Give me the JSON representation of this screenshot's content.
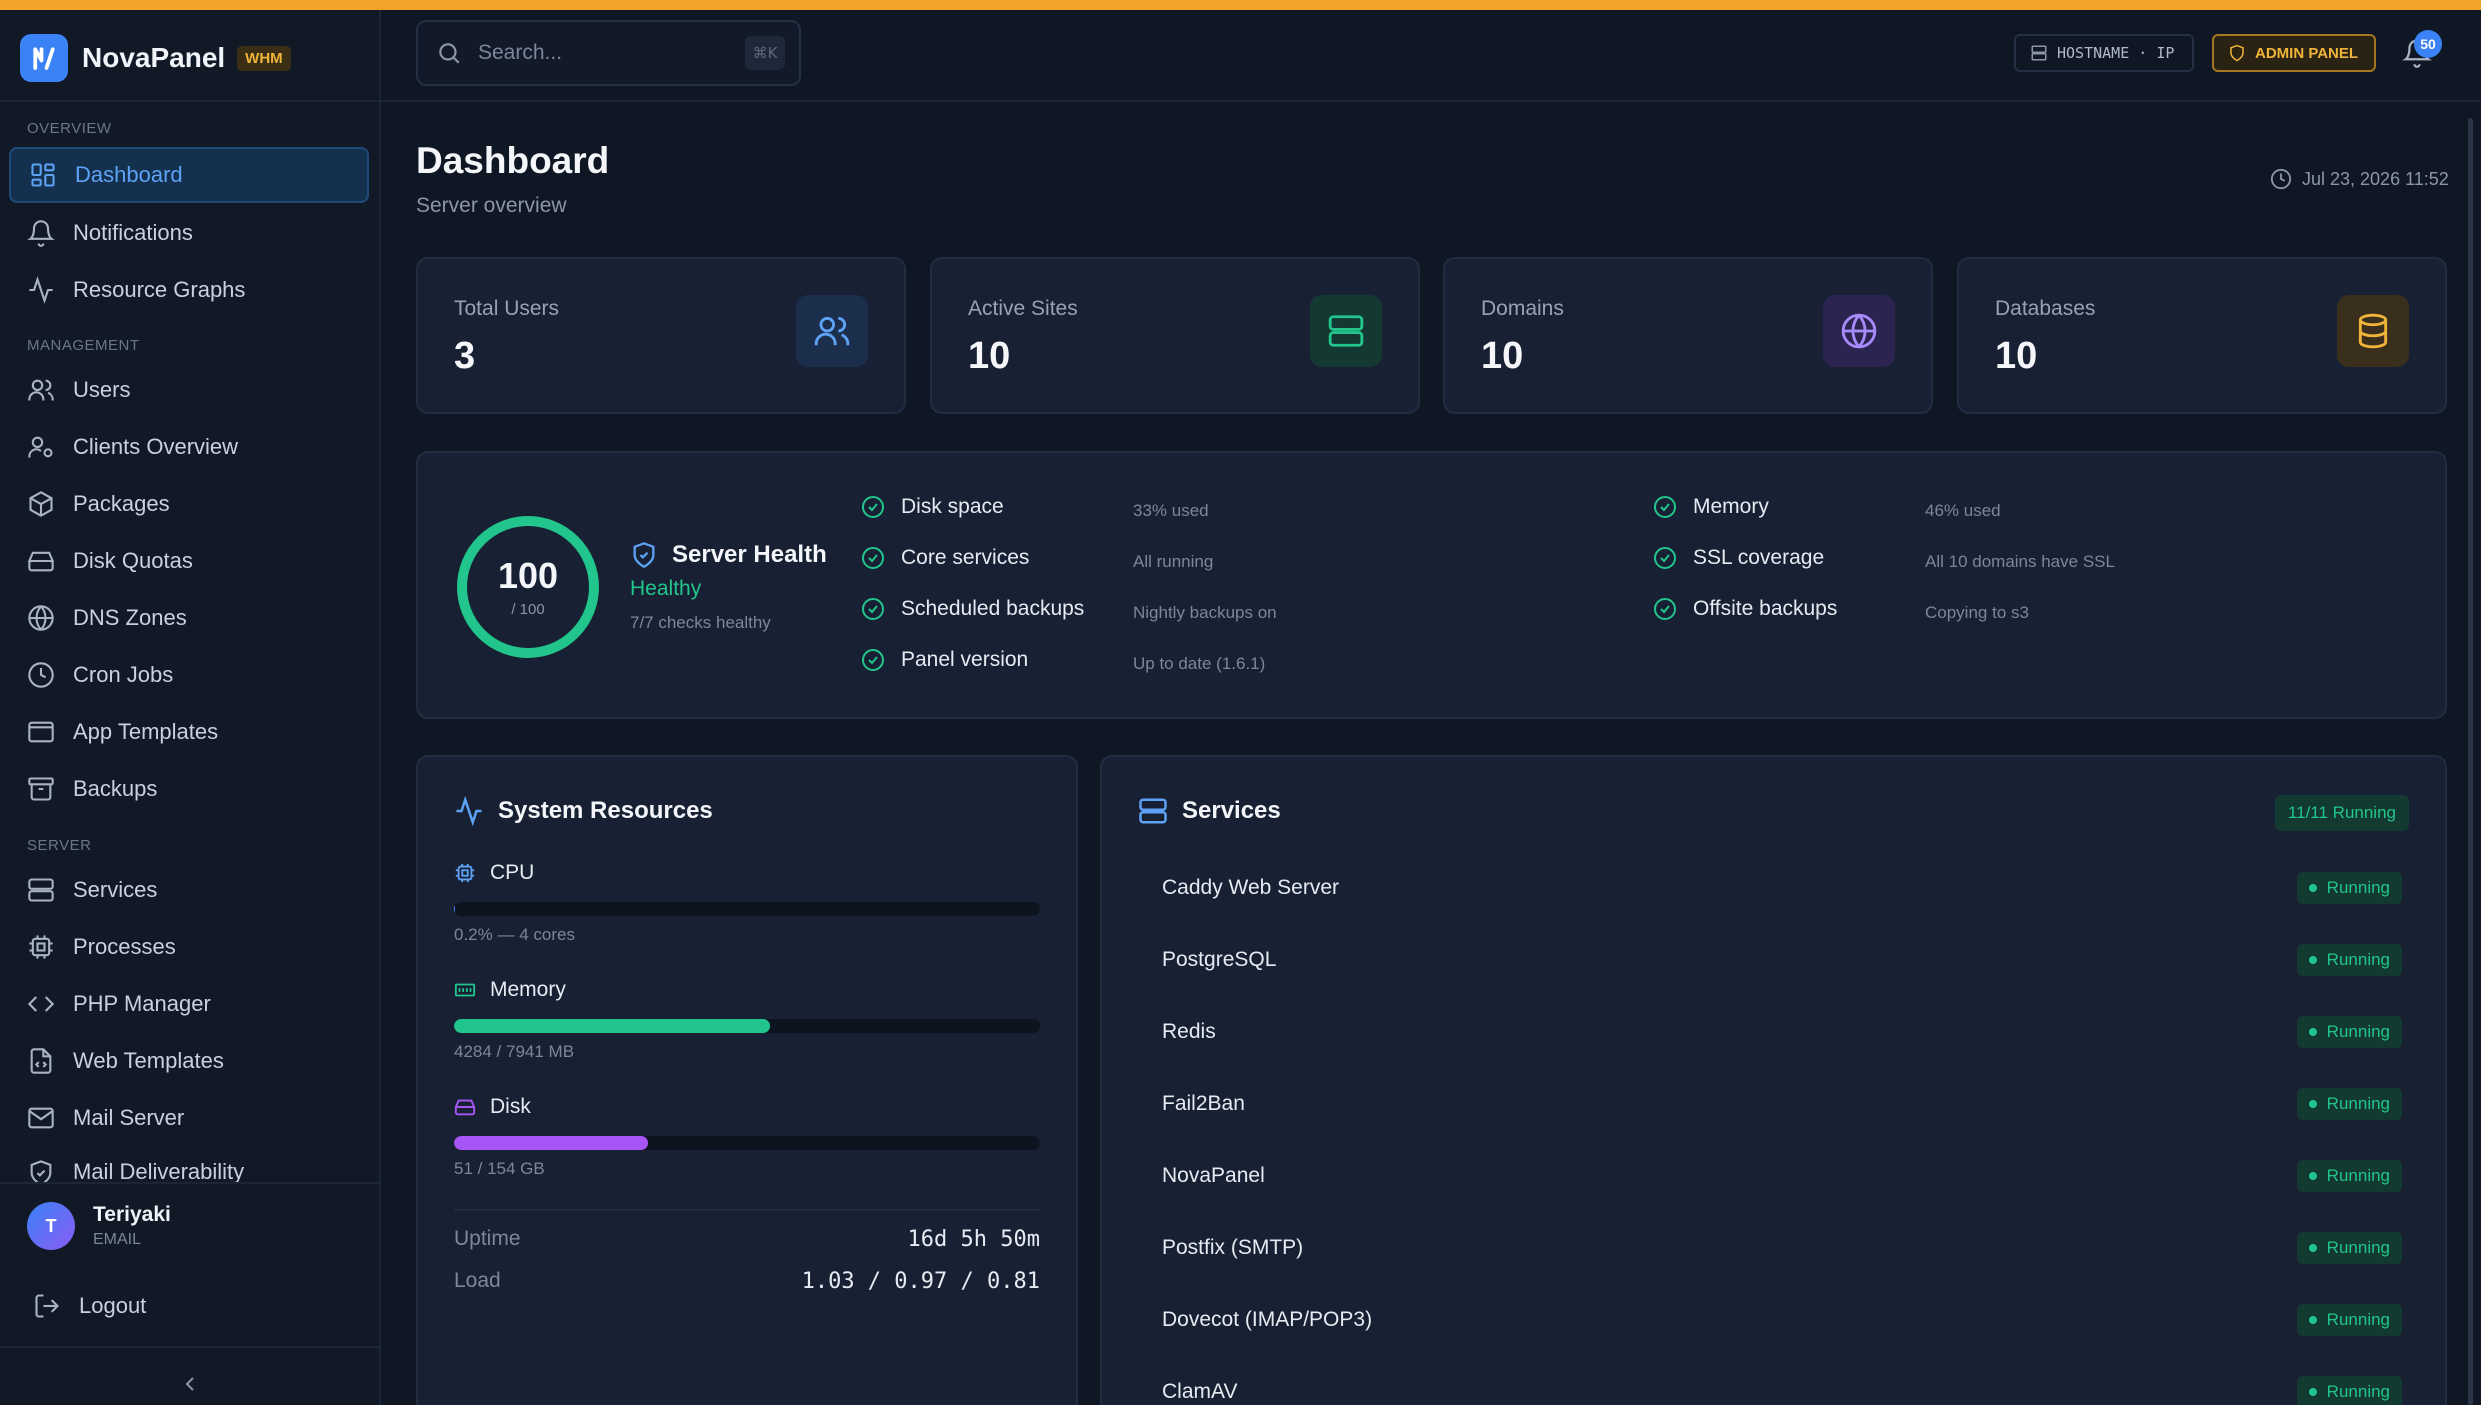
{
  "brand": {
    "name": "NovaPanel",
    "badge": "WHM"
  },
  "search": {
    "placeholder": "Search...",
    "shortcut": "⌘K"
  },
  "header": {
    "host_chip": "HOSTNAME · IP",
    "admin_chip": "ADMIN PANEL",
    "notification_count": "50"
  },
  "sidebar": {
    "sections": {
      "overview": "OVERVIEW",
      "management": "MANAGEMENT",
      "server": "SERVER"
    },
    "items": {
      "dashboard": "Dashboard",
      "notifications": "Notifications",
      "resource_graphs": "Resource Graphs",
      "users": "Users",
      "clients_overview": "Clients Overview",
      "packages": "Packages",
      "disk_quotas": "Disk Quotas",
      "dns_zones": "DNS Zones",
      "cron_jobs": "Cron Jobs",
      "app_templates": "App Templates",
      "backups": "Backups",
      "services": "Services",
      "processes": "Processes",
      "php_manager": "PHP Manager",
      "web_templates": "Web Templates",
      "mail_server": "Mail Server",
      "mail_deliverability": "Mail Deliverability"
    },
    "user": {
      "initial": "T",
      "name": "Teriyaki",
      "role": "EMAIL"
    },
    "logout": "Logout"
  },
  "page": {
    "title": "Dashboard",
    "subtitle": "Server overview",
    "datetime": "Jul 23, 2026 11:52"
  },
  "stats": [
    {
      "label": "Total Users",
      "value": "3"
    },
    {
      "label": "Active Sites",
      "value": "10"
    },
    {
      "label": "Domains",
      "value": "10"
    },
    {
      "label": "Databases",
      "value": "10"
    }
  ],
  "health": {
    "score": "100",
    "max": "/ 100",
    "title": "Server Health",
    "status": "Healthy",
    "summary": "7/7 checks healthy",
    "checks": [
      {
        "label": "Disk space",
        "detail": "33% used"
      },
      {
        "label": "Core services",
        "detail": "All running"
      },
      {
        "label": "Scheduled backups",
        "detail": "Nightly backups on"
      },
      {
        "label": "Panel version",
        "detail": "Up to date (1.6.1)"
      },
      {
        "label": "Memory",
        "detail": "46% used"
      },
      {
        "label": "SSL coverage",
        "detail": "All 10 domains have SSL"
      },
      {
        "label": "Offsite backups",
        "detail": "Copying to s3"
      }
    ]
  },
  "system": {
    "title": "System Resources",
    "cpu": {
      "label": "CPU",
      "meta": "0.2% — 4 cores",
      "percent": 0.2
    },
    "memory": {
      "label": "Memory",
      "meta": "4284 / 7941 MB",
      "percent": 53.9
    },
    "disk": {
      "label": "Disk",
      "meta": "51 / 154 GB",
      "percent": 33.1
    },
    "uptime_label": "Uptime",
    "uptime": "16d 5h 50m",
    "load_label": "Load",
    "load": "1.03 / 0.97 / 0.81"
  },
  "services": {
    "title": "Services",
    "count": "11/11 Running",
    "items": [
      {
        "name": "Caddy Web Server",
        "status": "Running"
      },
      {
        "name": "PostgreSQL",
        "status": "Running"
      },
      {
        "name": "Redis",
        "status": "Running"
      },
      {
        "name": "Fail2Ban",
        "status": "Running"
      },
      {
        "name": "NovaPanel",
        "status": "Running"
      },
      {
        "name": "Postfix (SMTP)",
        "status": "Running"
      },
      {
        "name": "Dovecot (IMAP/POP3)",
        "status": "Running"
      },
      {
        "name": "ClamAV",
        "status": "Running"
      }
    ]
  },
  "colors": {
    "accent": "#3b82f6",
    "success": "#22c58b",
    "warning": "#f0b43a",
    "purple": "#a855f7",
    "background": "#0f1624"
  }
}
